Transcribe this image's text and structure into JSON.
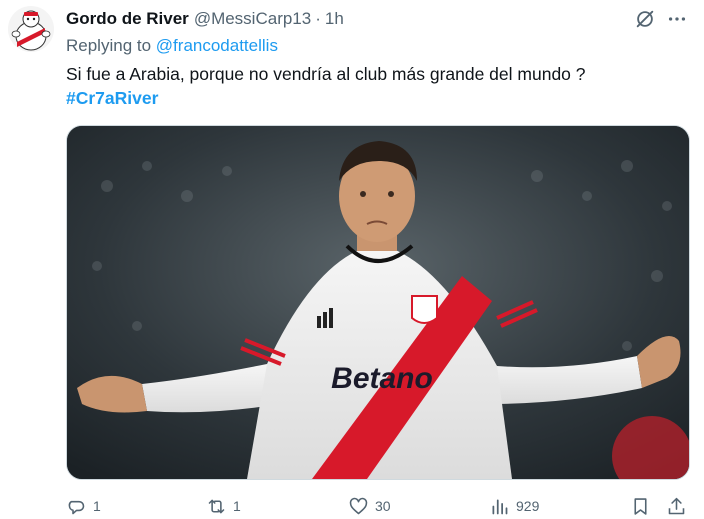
{
  "tweet": {
    "display_name": "Gordo de River",
    "handle": "@MessiCarp13",
    "separator": "·",
    "time": "1h",
    "replying_prefix": "Replying to",
    "replying_mention": "@francodattellis",
    "text": "Si fue a Arabia, porque no vendría al club más grande del mundo ?",
    "hashtag": "#Cr7aRiver"
  },
  "media": {
    "jersey_sponsor": "Betano",
    "description_icon": "photo"
  },
  "actions": {
    "replies": "1",
    "retweets": "1",
    "likes": "30",
    "views": "929"
  },
  "icons": {
    "reply": "reply-icon",
    "retweet": "retweet-icon",
    "like": "like-icon",
    "views": "views-icon",
    "bookmark": "bookmark-icon",
    "share": "share-icon",
    "grok": "grok-icon",
    "more": "more-icon"
  },
  "colors": {
    "accent": "#1d9bf0",
    "secondary_text": "#536471",
    "primary_text": "#0f1419",
    "river_red": "#d7192a"
  }
}
